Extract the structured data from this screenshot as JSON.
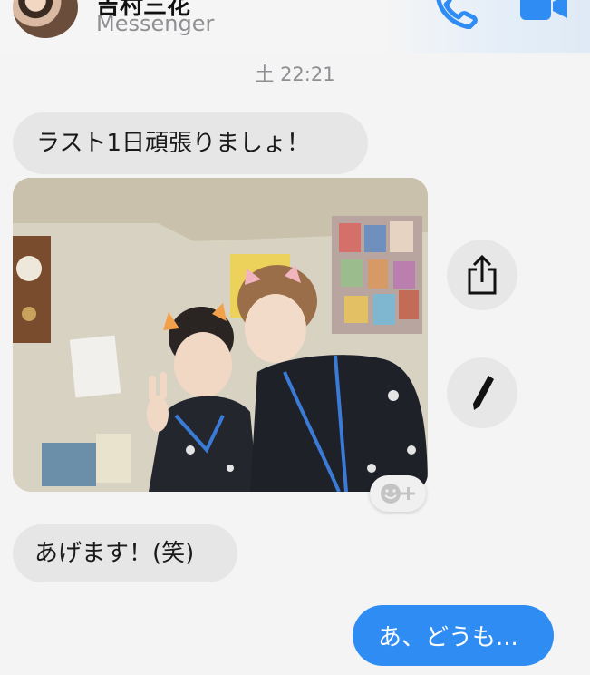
{
  "header": {
    "contact_name": "吉村三花",
    "app_label": "Messenger",
    "call_icon": "phone-icon",
    "video_icon": "video-camera-icon",
    "accent_color": "#2f8cf3"
  },
  "timestamp": "土 22:21",
  "messages": [
    {
      "id": "m1",
      "direction": "incoming",
      "type": "text",
      "text": "ラスト1日頑張りましょ！"
    },
    {
      "id": "m2",
      "direction": "incoming",
      "type": "photo"
    },
    {
      "id": "m3",
      "direction": "incoming",
      "type": "text",
      "text": "あげます！(笑)"
    },
    {
      "id": "m4",
      "direction": "outgoing",
      "type": "text",
      "text": "あ、どうも..."
    }
  ],
  "photo_actions": {
    "share_icon": "share-icon",
    "edit_icon": "pencil-icon",
    "reaction_icon": "add-reaction-icon"
  }
}
